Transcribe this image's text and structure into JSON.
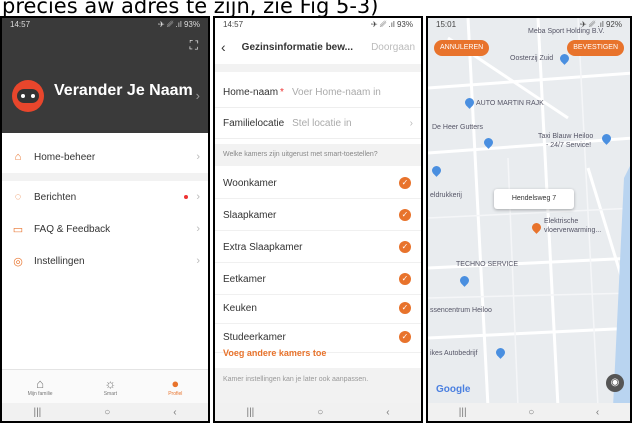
{
  "caption": "precies aw adres te zijn, zie Fig 5-3)",
  "phone1": {
    "status_time": "14:57",
    "status_icons": "✈ ␥ .ıl 93%",
    "user_name": "Verander Je Naam",
    "menu": [
      {
        "label": "Home-beheer",
        "icon": "home-icon"
      },
      {
        "label": "Berichten",
        "icon": "message-icon",
        "badge": true
      },
      {
        "label": "FAQ & Feedback",
        "icon": "faq-icon"
      },
      {
        "label": "Instellingen",
        "icon": "settings-icon"
      }
    ],
    "tabs": [
      {
        "label": "Mijn familie",
        "icon": "home-tab-icon"
      },
      {
        "label": "Smart",
        "icon": "smart-tab-icon"
      },
      {
        "label": "Profiel",
        "icon": "profile-tab-icon",
        "active": true
      }
    ]
  },
  "phone2": {
    "status_time": "14:57",
    "status_icons": "✈ ␥ .ıl 93%",
    "title": "Gezinsinformatie bew...",
    "next_label": "Doorgaan",
    "home_name_label": "Home-naam",
    "home_name_placeholder": "Voer Home-naam in",
    "location_label": "Familielocatie",
    "location_placeholder": "Stel locatie in",
    "rooms_prompt": "Welke kamers zijn uitgerust met smart-toestellen?",
    "rooms": [
      "Woonkamer",
      "Slaapkamer",
      "Extra Slaapkamer",
      "Eetkamer",
      "Keuken",
      "Studeerkamer"
    ],
    "add_rooms": "Voeg andere kamers toe",
    "footer_note": "Kamer instellingen kan je later ook aanpassen."
  },
  "phone3": {
    "status_time": "15:01",
    "status_icons": "✈ ␥ .ıl 92%",
    "cancel_label": "ANNULEREN",
    "confirm_label": "BEVESTIGEN",
    "callout": "Hendelsweg 7",
    "google": "Google",
    "labels": {
      "meba": "Meba Sport Holding B.V.",
      "oosterzij": "Oosterzij Zuid",
      "auto": "AUTO MARTIN RAJK",
      "deheer": "De Heer Gutters",
      "taxi1": "Taxi Blauw Heiloo",
      "taxi2": "- 24/7 Service!",
      "drukkerij": "eldrukkerij",
      "elektrische1": "Elektrische",
      "elektrische2": "vloerverwarming...",
      "techno": "TECHNO SERVICE",
      "centrum": "ssencentrum Heiloo",
      "autobedrijf": "ikes Autobedrijf"
    }
  }
}
